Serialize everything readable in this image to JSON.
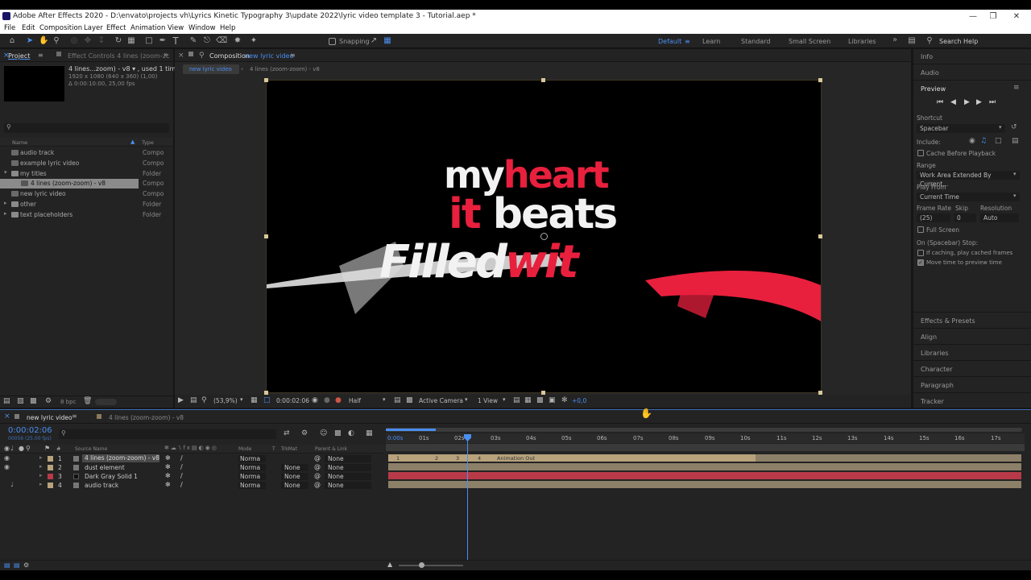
{
  "window": {
    "title": "Adobe After Effects 2020 - D:\\envato\\projects vh\\Lyrics Kinetic Typography 3\\update 2022\\lyric video template 3 - Tutorial.aep *"
  },
  "menu": [
    "File",
    "Edit",
    "Composition",
    "Layer",
    "Effect",
    "Animation",
    "View",
    "Window",
    "Help"
  ],
  "toolbar": {
    "snapping": "Snapping"
  },
  "workspaces": [
    "Default",
    "Learn",
    "Standard",
    "Small Screen",
    "Libraries"
  ],
  "search_help": "Search Help",
  "project": {
    "tab": "Project",
    "effect_controls": "Effect Controls 4 lines (zoom-zc",
    "selected_name": "4 lines...zoom) - v8 ▾ , used 1 time",
    "selected_res": "1920 x 1080  (640 x 360) (1,00)",
    "selected_dur": "Δ 0:00:10:00, 25,00 fps",
    "col_name": "Name",
    "col_type": "Type",
    "items": [
      {
        "name": "audio track",
        "type": "Compo"
      },
      {
        "name": "example lyric video",
        "type": "Compo"
      },
      {
        "name": "my titles",
        "type": "Folder"
      },
      {
        "name": "4 lines (zoom-zoom) - v8",
        "type": "Compo"
      },
      {
        "name": "new lyric video",
        "type": "Compo"
      },
      {
        "name": "other",
        "type": "Folder"
      },
      {
        "name": "text placeholders",
        "type": "Folder"
      }
    ],
    "bpc": "8 bpc"
  },
  "composition": {
    "tab_label": "Composition",
    "tab_name": "new lyric video",
    "crumb1": "new lyric video",
    "crumb2": "4 lines (zoom-zoom) - v8",
    "lyrics_line1_white": "my",
    "lyrics_line1_red": "heart",
    "lyrics_line2_red": "it",
    "lyrics_line2_white": "beats",
    "lyrics_line3_white": "Filled",
    "lyrics_line3_red": "wit",
    "zoom": "(53,9%)",
    "timecode": "0:00:02:06",
    "resolution": "Half",
    "camera": "Active Camera",
    "view": "1 View",
    "exposure": "+0,0"
  },
  "right_panel": {
    "info": "Info",
    "audio": "Audio",
    "preview": "Preview",
    "shortcut_label": "Shortcut",
    "shortcut": "Spacebar",
    "include": "Include:",
    "cache": "Cache Before Playback",
    "range_label": "Range",
    "range": "Work Area Extended By Current...",
    "playfrom_label": "Play From",
    "playfrom": "Current Time",
    "framerate_label": "Frame Rate",
    "skip_label": "Skip",
    "resolution_label": "Resolution",
    "framerate": "(25)",
    "skip": "0",
    "resolution": "Auto",
    "fullscreen": "Full Screen",
    "stop_label": "On (Spacebar) Stop:",
    "if_caching": "If caching, play cached frames",
    "move_time": "Move time to preview time",
    "sections": [
      "Effects & Presets",
      "Align",
      "Libraries",
      "Character",
      "Paragraph",
      "Tracker"
    ]
  },
  "timeline": {
    "tab1": "new lyric video",
    "tab2": "4 lines (zoom-zoom) - v8",
    "timecode": "0:00:02:06",
    "frames": "00056 (25.00 fps)",
    "col_source": "Source Name",
    "col_mode": "Mode",
    "col_t": "T",
    "col_trkmat": "TrkMat",
    "col_parent": "Parent & Link",
    "ruler": [
      "0:00s",
      "01s",
      "02s",
      "03s",
      "04s",
      "05s",
      "06s",
      "07s",
      "08s",
      "09s",
      "10s",
      "11s",
      "12s",
      "13s",
      "14s",
      "15s",
      "16s",
      "17s"
    ],
    "marker_label": "Animation Out",
    "markers": [
      "1",
      "2",
      "3",
      "4"
    ],
    "layers": [
      {
        "num": "1",
        "name": "4 lines (zoom-zoom) - v8",
        "mode": "Norma",
        "trkmat": "",
        "parent": "None",
        "color": "#b7a27c"
      },
      {
        "num": "2",
        "name": "dust element",
        "mode": "Norma",
        "trkmat": "None",
        "parent": "None",
        "color": "#b7a27c"
      },
      {
        "num": "3",
        "name": "Dark Gray Solid 1",
        "mode": "Norma",
        "trkmat": "None",
        "parent": "None",
        "color": "#b83a48"
      },
      {
        "num": "4",
        "name": "audio track",
        "mode": "Norma",
        "trkmat": "None",
        "parent": "None",
        "color": "#b7a27c"
      }
    ]
  }
}
